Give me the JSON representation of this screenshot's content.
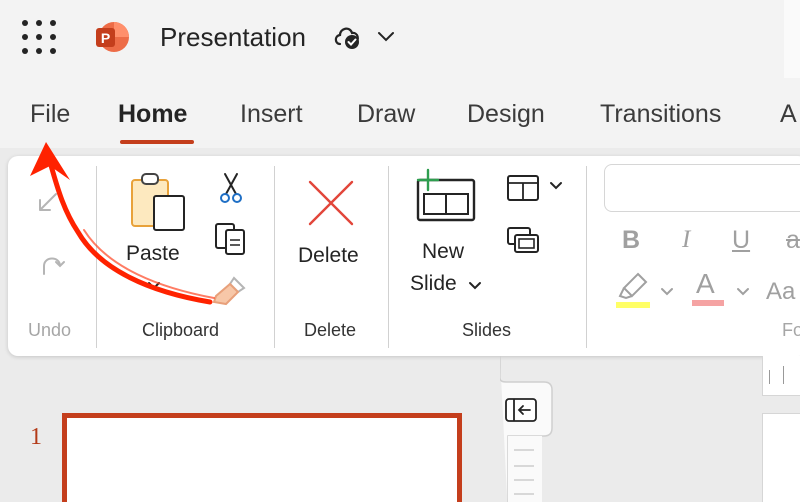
{
  "titlebar": {
    "doc_title": "Presentation",
    "app_icon": "powerpoint-logo",
    "app_letter": "P",
    "brand_color": "#c43e1c"
  },
  "tabs": [
    "File",
    "Home",
    "Insert",
    "Draw",
    "Design",
    "Transitions",
    "A"
  ],
  "active_tab": "Home",
  "ribbon": {
    "undo_group": "Undo",
    "clipboard": {
      "paste": "Paste",
      "group": "Clipboard"
    },
    "delete": {
      "label": "Delete",
      "group": "Delete"
    },
    "slides": {
      "new_line1": "New",
      "new_line2": "Slide",
      "group": "Slides"
    },
    "font": {
      "bold": "B",
      "italic": "I",
      "underline": "U",
      "strike": "a",
      "font_color_letter": "A",
      "change_case": "Aa",
      "group_partial": "Fo"
    }
  },
  "slides_pane": {
    "slide_number": "1"
  },
  "annotation": {
    "color": "#ff2200"
  }
}
